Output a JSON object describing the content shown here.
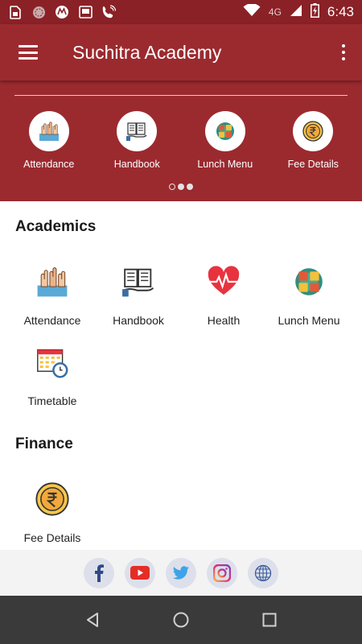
{
  "status_bar": {
    "time": "6:43",
    "network": "4G",
    "icons": [
      "sim-icon",
      "dnd-icon",
      "motorola-icon",
      "screenshot-icon",
      "wifi-calling-icon",
      "wifi-icon",
      "signal-icon",
      "battery-charging-icon"
    ]
  },
  "app_bar": {
    "title": "Suchitra Academy",
    "menu_icon": "hamburger-menu-icon",
    "more_icon": "overflow-menu-icon",
    "color": "#9b2a2f"
  },
  "banner": {
    "items": [
      {
        "label": "Attendance",
        "icon": "attendance-hands-icon"
      },
      {
        "label": "Handbook",
        "icon": "handbook-icon"
      },
      {
        "label": "Lunch Menu",
        "icon": "lunch-menu-icon"
      },
      {
        "label": "Fee Details",
        "icon": "rupee-coin-icon"
      }
    ],
    "page_count": 3,
    "active_page": 1
  },
  "sections": {
    "academics": {
      "title": "Academics",
      "items": [
        {
          "label": "Attendance",
          "icon": "attendance-hands-icon"
        },
        {
          "label": "Handbook",
          "icon": "handbook-icon"
        },
        {
          "label": "Health",
          "icon": "heart-pulse-icon"
        },
        {
          "label": "Lunch Menu",
          "icon": "lunch-menu-icon"
        },
        {
          "label": "Timetable",
          "icon": "calendar-clock-icon"
        }
      ]
    },
    "finance": {
      "title": "Finance",
      "items": [
        {
          "label": "Fee Details",
          "icon": "rupee-coin-icon"
        }
      ]
    }
  },
  "social": [
    "facebook-icon",
    "youtube-icon",
    "twitter-icon",
    "instagram-icon",
    "website-globe-icon"
  ],
  "nav": [
    "back-icon",
    "home-icon",
    "recents-icon"
  ]
}
